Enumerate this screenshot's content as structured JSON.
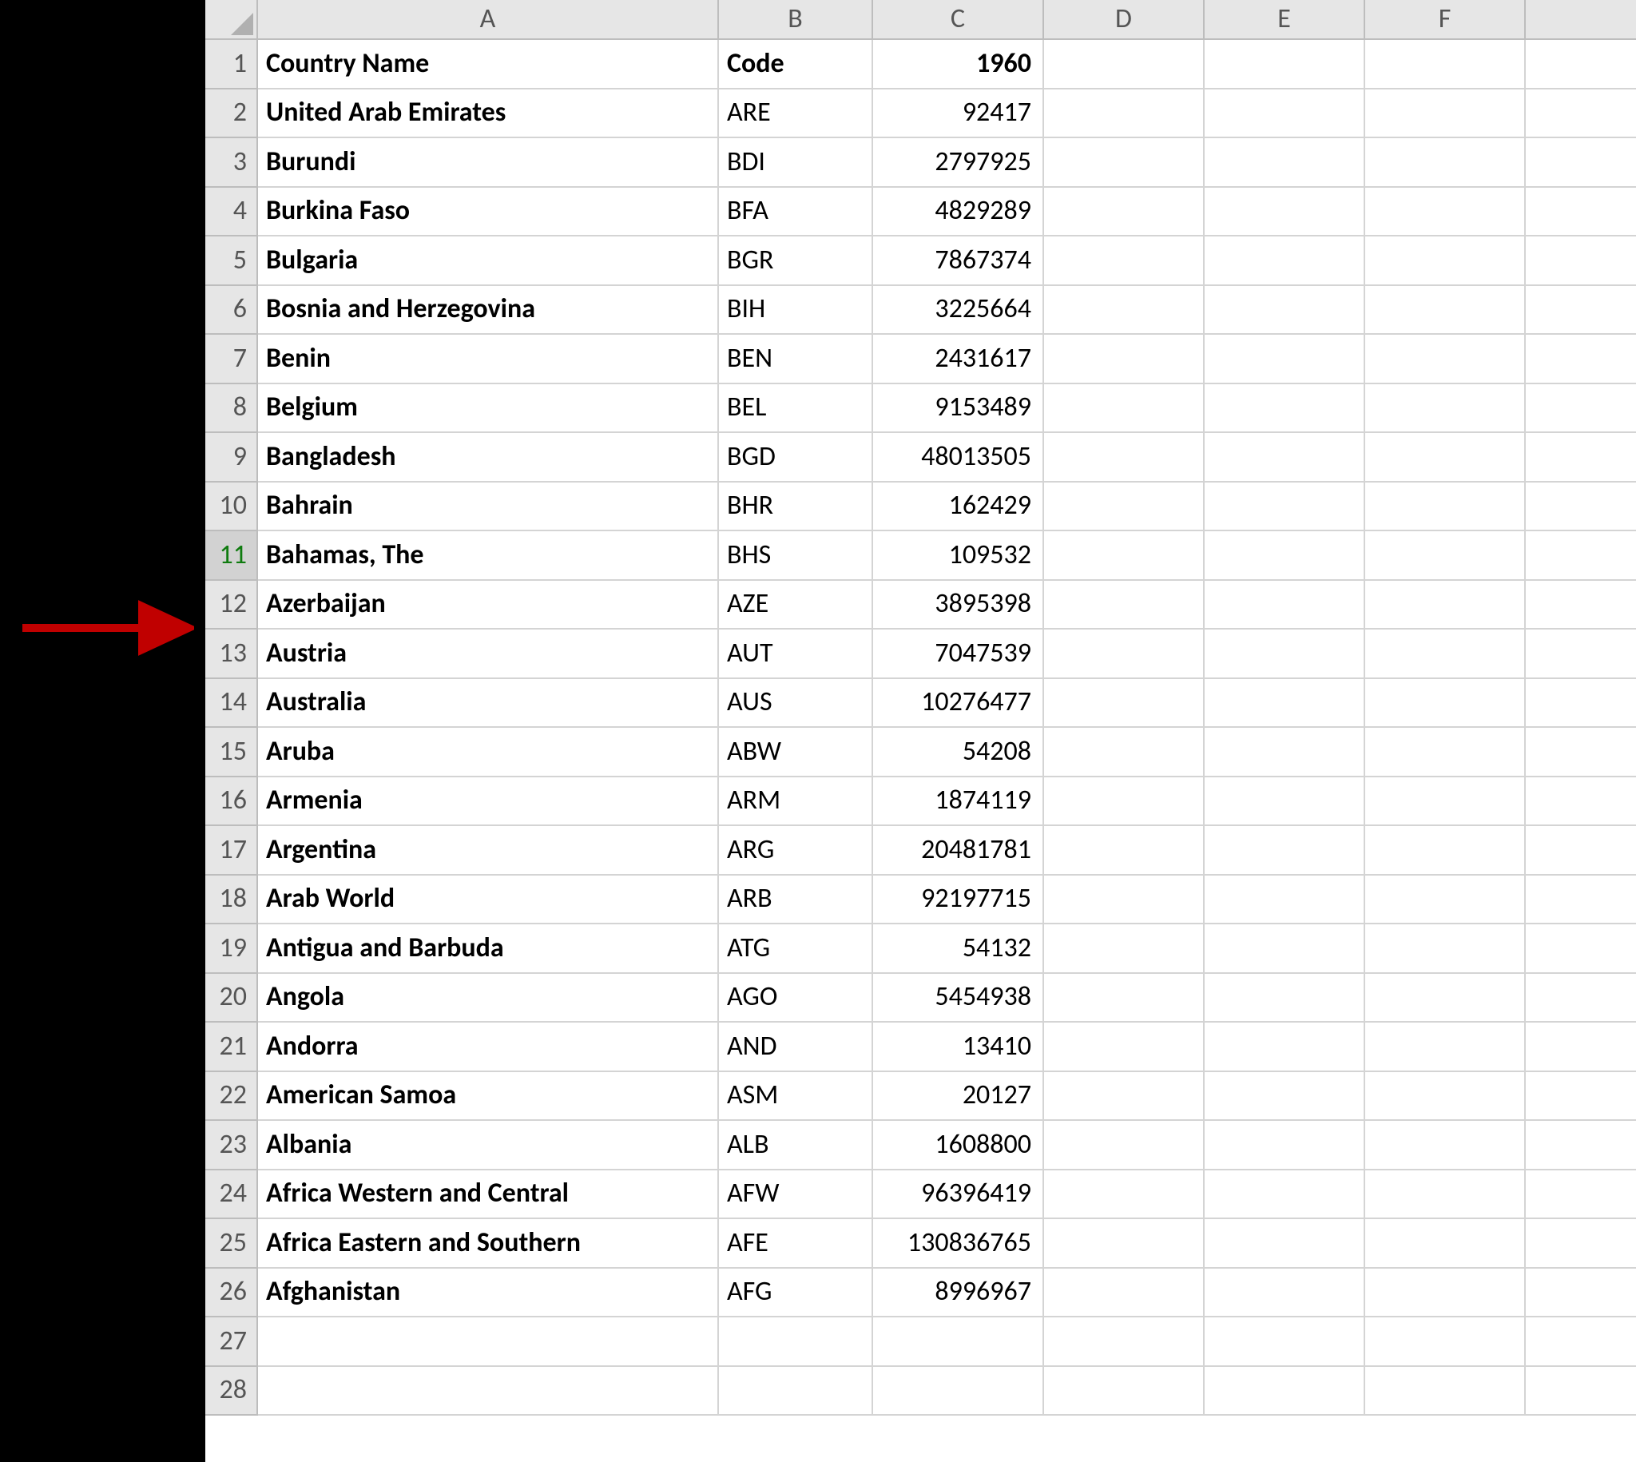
{
  "columns": [
    "A",
    "B",
    "C",
    "D",
    "E",
    "F"
  ],
  "selected_row": 11,
  "rows": [
    {
      "n": 1,
      "a": "Country Name",
      "b": "Code",
      "c": "1960",
      "bold_row": true
    },
    {
      "n": 2,
      "a": "United Arab Emirates",
      "b": "ARE",
      "c": "92417"
    },
    {
      "n": 3,
      "a": "Burundi",
      "b": "BDI",
      "c": "2797925"
    },
    {
      "n": 4,
      "a": "Burkina Faso",
      "b": "BFA",
      "c": "4829289"
    },
    {
      "n": 5,
      "a": "Bulgaria",
      "b": "BGR",
      "c": "7867374"
    },
    {
      "n": 6,
      "a": "Bosnia and Herzegovina",
      "b": "BIH",
      "c": "3225664"
    },
    {
      "n": 7,
      "a": "Benin",
      "b": "BEN",
      "c": "2431617"
    },
    {
      "n": 8,
      "a": "Belgium",
      "b": "BEL",
      "c": "9153489"
    },
    {
      "n": 9,
      "a": "Bangladesh",
      "b": "BGD",
      "c": "48013505"
    },
    {
      "n": 10,
      "a": "Bahrain",
      "b": "BHR",
      "c": "162429"
    },
    {
      "n": 11,
      "a": "Bahamas, The",
      "b": "BHS",
      "c": "109532"
    },
    {
      "n": 12,
      "a": "Azerbaijan",
      "b": "AZE",
      "c": "3895398"
    },
    {
      "n": 13,
      "a": "Austria",
      "b": "AUT",
      "c": "7047539"
    },
    {
      "n": 14,
      "a": "Australia",
      "b": "AUS",
      "c": "10276477"
    },
    {
      "n": 15,
      "a": "Aruba",
      "b": "ABW",
      "c": "54208"
    },
    {
      "n": 16,
      "a": "Armenia",
      "b": "ARM",
      "c": "1874119"
    },
    {
      "n": 17,
      "a": "Argentina",
      "b": "ARG",
      "c": "20481781"
    },
    {
      "n": 18,
      "a": "Arab World",
      "b": "ARB",
      "c": "92197715"
    },
    {
      "n": 19,
      "a": "Antigua and Barbuda",
      "b": "ATG",
      "c": "54132"
    },
    {
      "n": 20,
      "a": "Angola",
      "b": "AGO",
      "c": "5454938"
    },
    {
      "n": 21,
      "a": "Andorra",
      "b": "AND",
      "c": "13410"
    },
    {
      "n": 22,
      "a": "American Samoa",
      "b": "ASM",
      "c": "20127"
    },
    {
      "n": 23,
      "a": "Albania",
      "b": "ALB",
      "c": "1608800"
    },
    {
      "n": 24,
      "a": "Africa Western and Central",
      "b": "AFW",
      "c": "96396419"
    },
    {
      "n": 25,
      "a": "Africa Eastern and Southern",
      "b": "AFE",
      "c": "130836765"
    },
    {
      "n": 26,
      "a": "Afghanistan",
      "b": "AFG",
      "c": "8996967"
    },
    {
      "n": 27,
      "a": "",
      "b": "",
      "c": ""
    },
    {
      "n": 28,
      "a": "",
      "b": "",
      "c": ""
    }
  ],
  "annotation": {
    "name": "arrow-pointer",
    "color": "#c00000"
  }
}
